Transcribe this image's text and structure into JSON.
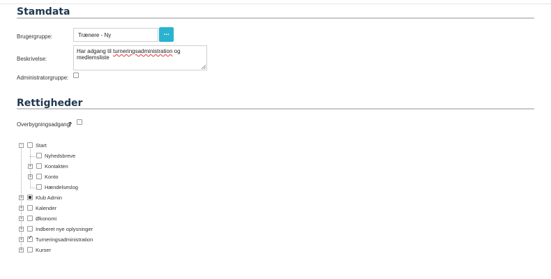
{
  "stamdata": {
    "title": "Stamdata",
    "brugergruppe_label": "Brugergruppe:",
    "brugergruppe_value": "Trænere - Ny",
    "lookup_button": "...",
    "beskrivelse_label": "Beskrivelse:",
    "beskrivelse_prefix": "Har adgang til ",
    "beskrivelse_spell": "turneringsadministration",
    "beskrivelse_suffix": " og medlemsliste",
    "administratorgruppe_label": "Administratorgruppe:",
    "administratorgruppe_checked": false
  },
  "rettigheder": {
    "title": "Rettigheder",
    "overbygning_label": "Overbygningsadgang:",
    "help": "?",
    "overbygning_checked": false,
    "tree": [
      {
        "label": "Start",
        "expander": "-",
        "state": "unchecked"
      },
      {
        "label": "Nyhedsbreve",
        "expander": "",
        "state": "unchecked"
      },
      {
        "label": "Kontakten",
        "expander": "+",
        "state": "unchecked"
      },
      {
        "label": "Konto",
        "expander": "+",
        "state": "unchecked"
      },
      {
        "label": "Hændelseslog",
        "expander": "",
        "state": "unchecked"
      },
      {
        "label": "Klub Admin",
        "expander": "+",
        "state": "partial"
      },
      {
        "label": "Kalender",
        "expander": "+",
        "state": "unchecked"
      },
      {
        "label": "Økonomi",
        "expander": "+",
        "state": "unchecked"
      },
      {
        "label": "Indberet nye oplysninger",
        "expander": "+",
        "state": "unchecked"
      },
      {
        "label": "Turneringsadministration",
        "expander": "+",
        "state": "checked"
      },
      {
        "label": "Kurser",
        "expander": "+",
        "state": "unchecked"
      }
    ]
  }
}
